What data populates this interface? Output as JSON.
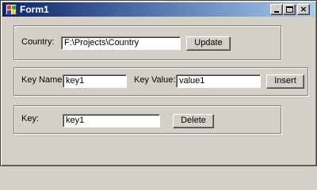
{
  "window": {
    "title": "Form1",
    "controls": {
      "minimize": "minimize",
      "maximize": "maximize",
      "close": "×"
    }
  },
  "country_group": {
    "label": "Country:",
    "value": "F:\\Projects\\Country",
    "button": "Update"
  },
  "insert_group": {
    "key_label": "Key Name:",
    "key_value": "key1",
    "value_label": "Key Value:",
    "value_value": "value1",
    "button": "Insert"
  },
  "delete_group": {
    "key_label": "Key:",
    "key_value": "key1",
    "button": "Delete"
  }
}
